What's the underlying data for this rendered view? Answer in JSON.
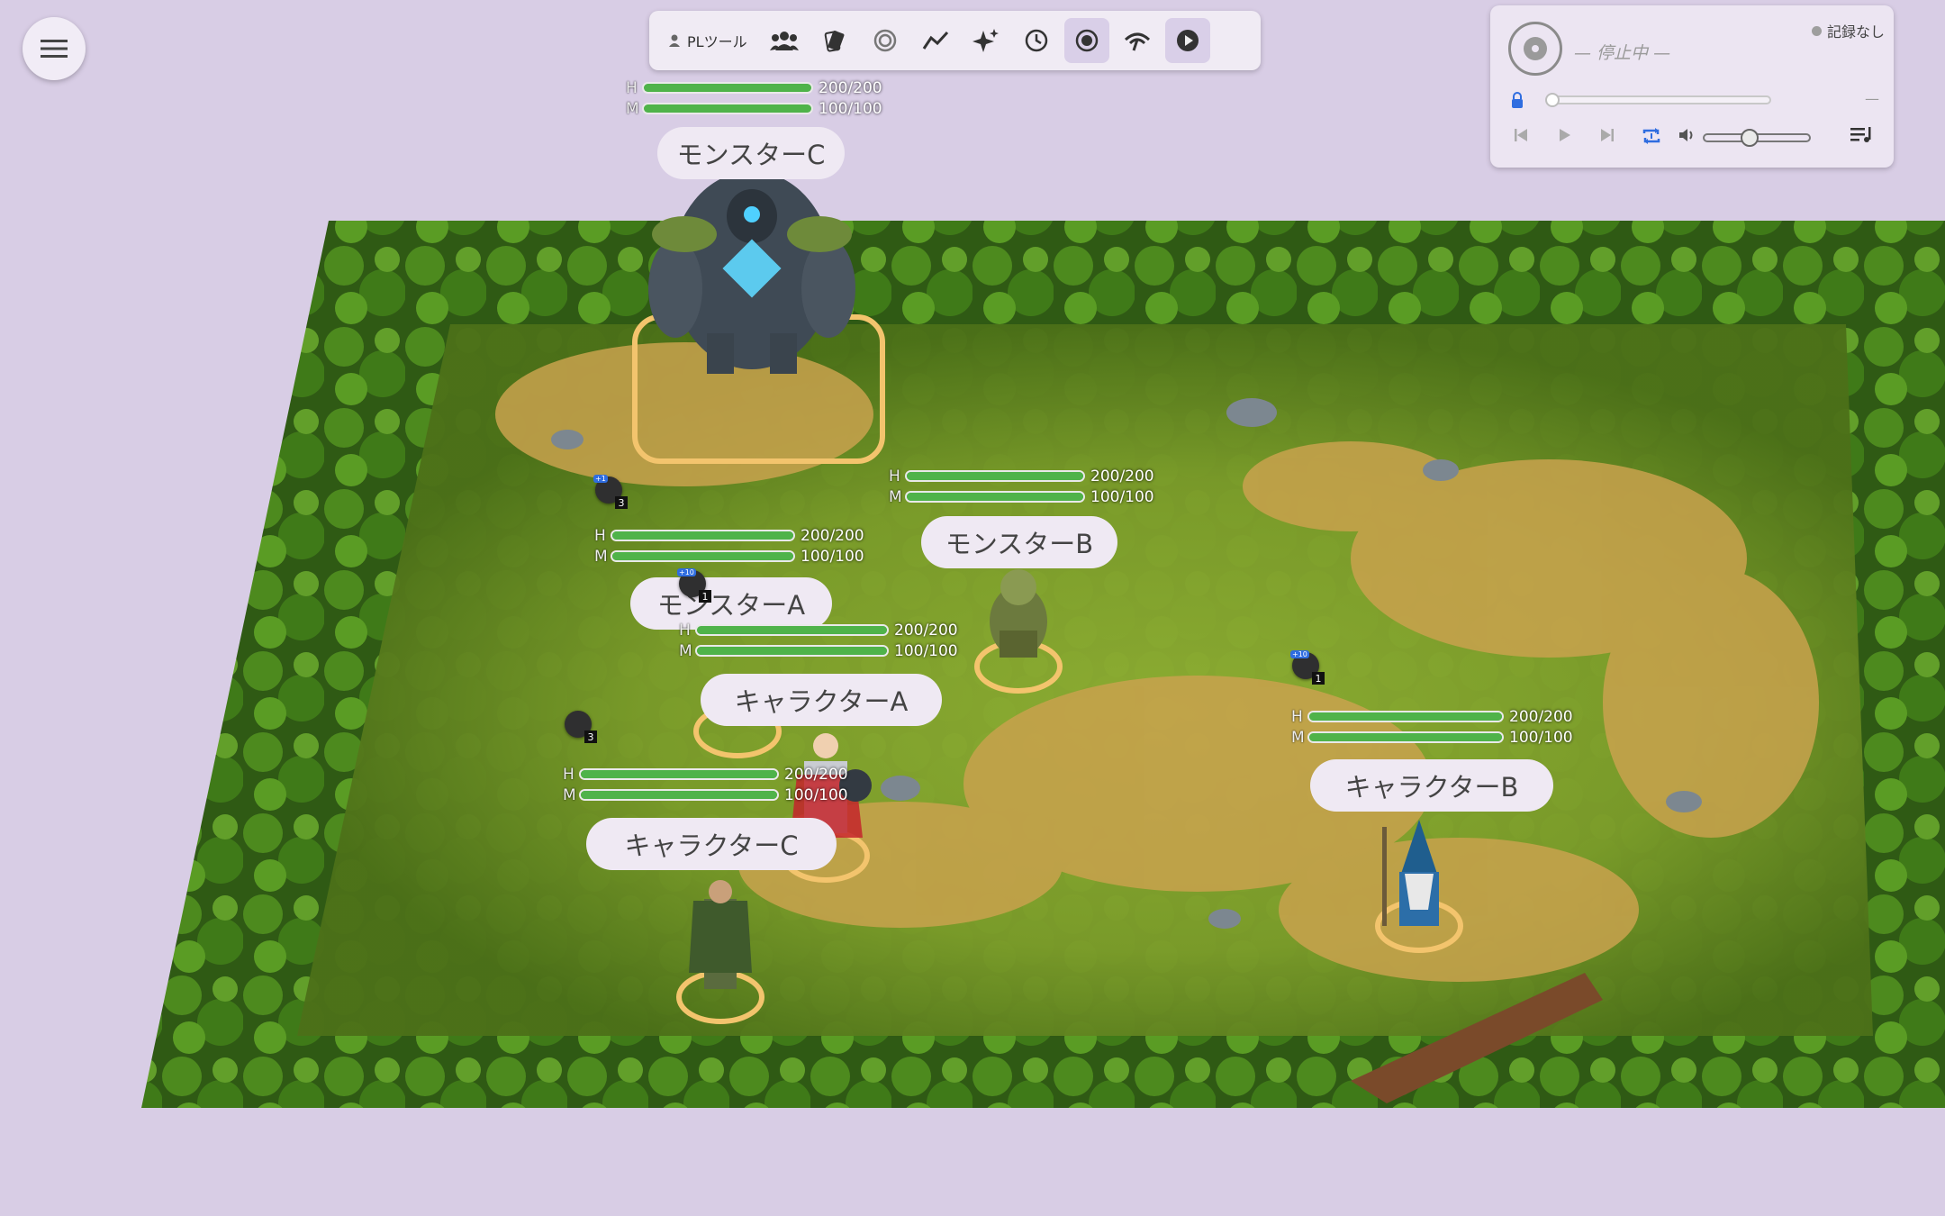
{
  "toolbar": {
    "pl_tools_label": "PLツール",
    "icons": [
      "people-icon",
      "cards-icon",
      "target-icon",
      "chart-line-icon",
      "sparkle-icon",
      "clock-icon",
      "record-icon",
      "signal-icon",
      "play-circle-icon"
    ]
  },
  "player": {
    "status": "— 停止中 —",
    "record_status": "記録なし",
    "duration": "—",
    "volume_level": 0.5,
    "seek_level": 0
  },
  "tokens": {
    "monster_c": {
      "name": "モンスターC",
      "hp": "200/200",
      "mp": "100/100",
      "hp_ratio": 1,
      "mp_ratio": 1
    },
    "monster_b": {
      "name": "モンスターB",
      "hp": "200/200",
      "mp": "100/100",
      "hp_ratio": 1,
      "mp_ratio": 1
    },
    "monster_a": {
      "name": "モンスターA",
      "hp": "200/200",
      "mp": "100/100",
      "hp_ratio": 1,
      "mp_ratio": 1
    },
    "character_a": {
      "name": "キャラクターA",
      "hp": "200/200",
      "mp": "100/100",
      "hp_ratio": 1,
      "mp_ratio": 1
    },
    "character_b": {
      "name": "キャラクターB",
      "hp": "200/200",
      "mp": "100/100",
      "hp_ratio": 1,
      "mp_ratio": 1
    },
    "character_c": {
      "name": "キャラクターC",
      "hp": "200/200",
      "mp": "100/100",
      "hp_ratio": 1,
      "mp_ratio": 1
    }
  },
  "bar_labels": {
    "hp": "H",
    "mp": "M"
  },
  "effects": [
    {
      "badge": "+1",
      "count": "3"
    },
    {
      "badge": "+10",
      "count": "1"
    },
    {
      "badge": "",
      "count": "3"
    },
    {
      "badge": "+10",
      "count": "1"
    }
  ],
  "colors": {
    "bar_fill": "#4fb34a",
    "accent": "#2f6de0",
    "ring": "#f3c46d",
    "background": "#d8cde5"
  }
}
